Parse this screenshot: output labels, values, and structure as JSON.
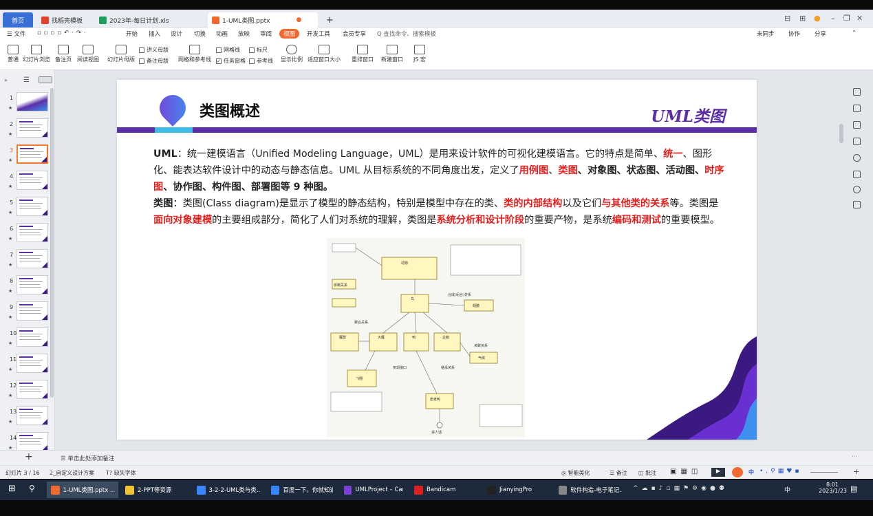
{
  "tabs": {
    "home": "首页",
    "items": [
      {
        "label": "找稻壳模板",
        "color": "#e0412c"
      },
      {
        "label": "2023年-每日计划.xls",
        "color": "#1d9e5a"
      },
      {
        "label": "1-UML类图.pptx",
        "color": "#f06a2f"
      }
    ],
    "new_tab": "+"
  },
  "menu": {
    "file": "☰ 文件",
    "items": [
      "开始",
      "插入",
      "设计",
      "切换",
      "动画",
      "放映",
      "审阅",
      "视图",
      "开发工具",
      "会员专享"
    ],
    "active": "视图",
    "search": "Q 查找命令、搜索模板",
    "right": [
      "未同步",
      "协作",
      "分享"
    ]
  },
  "ribbon": {
    "big": [
      "普通",
      "幻灯片浏览",
      "备注页",
      "阅读视图",
      "幻灯片母版",
      "网格和参考线",
      "显示比例",
      "适应窗口大小",
      "重排窗口",
      "新建窗口",
      "JS 宏"
    ],
    "讲义母版": "讲义母版",
    "备注母版": "备注母版",
    "checks": [
      {
        "label": "网格线",
        "checked": false
      },
      {
        "label": "标尺",
        "checked": false
      },
      {
        "label": "任务窗格",
        "checked": true
      },
      {
        "label": "参考线",
        "checked": false
      }
    ]
  },
  "thumbnails": {
    "count": 14,
    "selected": 3,
    "numbers": [
      "1",
      "2",
      "3",
      "4",
      "5",
      "6",
      "7",
      "8",
      "9",
      "10",
      "11",
      "12",
      "13",
      "14"
    ]
  },
  "slide": {
    "title": "类图概述",
    "badge": "UML类图",
    "para1": {
      "lead": "UML",
      "text1": "：统一建模语言（Unified Modeling Language，UML）是用来设计软件的可视化建模语言。它的特点是简单、",
      "red1": "统一",
      "text2": "、图形化、能表达软件设计中的动态与静态信息。UML 从目标系统的不同角度出发，定义了",
      "red2": "用例图",
      "sep1": "、",
      "red3": "类图",
      "text3": "、对象图、状态图、活动图、",
      "red4": "时序图",
      "text4": "、协作图、构件图、部署图等 9 种图。"
    },
    "para2": {
      "lead": "类图",
      "text1": "：类图(Class diagram)是显示了模型的静态结构，特别是模型中存在的类、",
      "red1": "类的内部结构",
      "text2": "以及它们",
      "red2": "与其他类的关系",
      "text3": "等。类图是",
      "red3": "面向对象建模",
      "text4": "的主要组成部分，简化了人们对系统的理解，类图是",
      "red4": "系统分析和设计阶段",
      "text5": "的重要产物，是系统",
      "red5": "编码和测试",
      "text6": "的重要模型。"
    },
    "diagram": {
      "classes": [
        "动物",
        "鸟",
        "翅膀",
        "大雁",
        "鸭",
        "企鹅",
        "雁群",
        "气候",
        "飞翔",
        "唐老鸭",
        "讲人话"
      ],
      "notes": [
        "依赖关系",
        "组合关系",
        "合成(组合)关系",
        "聚合关系",
        "关联关系",
        "继承关系",
        "实现接口"
      ]
    }
  },
  "notes_placeholder": "单击此处添加备注",
  "status": {
    "slide_no": "幻灯片 3 / 16",
    "theme": "2_自定义设计方案",
    "font_missing": "缺失字体",
    "smart": "智能美化",
    "notes": "备注",
    "comments": "批注",
    "zoom": "+"
  },
  "taskbar": {
    "apps": [
      {
        "label": "1-UML类图.pptx ...",
        "color": "#f06a2f",
        "active": true
      },
      {
        "label": "2-PPT等资源",
        "color": "#f1c232",
        "active": false
      },
      {
        "label": "3-2-2-UML类与类...",
        "color": "#3a86ff",
        "active": false
      },
      {
        "label": "百度一下，你就知道",
        "color": "#3a86ff",
        "active": false
      },
      {
        "label": "UMLProject – Car...",
        "color": "#7b3fd8",
        "active": false
      },
      {
        "label": "Bandicam",
        "color": "#e02020",
        "active": false
      },
      {
        "label": "JianyingPro",
        "color": "#222222",
        "active": false
      },
      {
        "label": "软件构造-电子笔记...",
        "color": "#888888",
        "active": false
      }
    ],
    "ime": "中",
    "time": "8:01",
    "date": "2023/1/23"
  }
}
